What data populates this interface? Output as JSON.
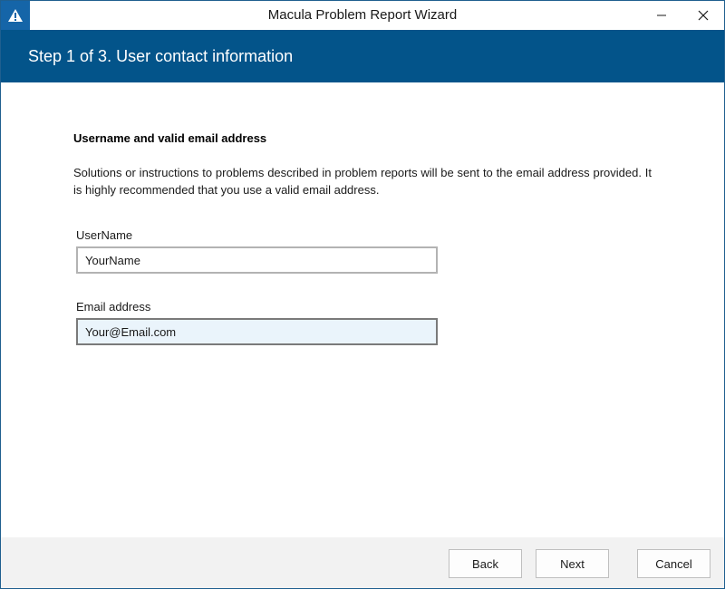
{
  "window": {
    "title": "Macula Problem Report Wizard",
    "app_icon": "warning-triangle-icon",
    "minimize_icon": "minimize-icon",
    "close_icon": "close-icon"
  },
  "header": {
    "step_title": "Step 1 of 3. User contact information",
    "band_color": "#03548a"
  },
  "content": {
    "section_heading": "Username and valid email address",
    "description": "Solutions or instructions to problems described in problem reports will be sent to the email address provided. It is highly recommended that you use a valid email address.",
    "username": {
      "label": "UserName",
      "value": "YourName"
    },
    "email": {
      "label": "Email address",
      "value": "Your@Email.com",
      "focused": true
    }
  },
  "footer": {
    "back_label": "Back",
    "next_label": "Next",
    "cancel_label": "Cancel"
  }
}
